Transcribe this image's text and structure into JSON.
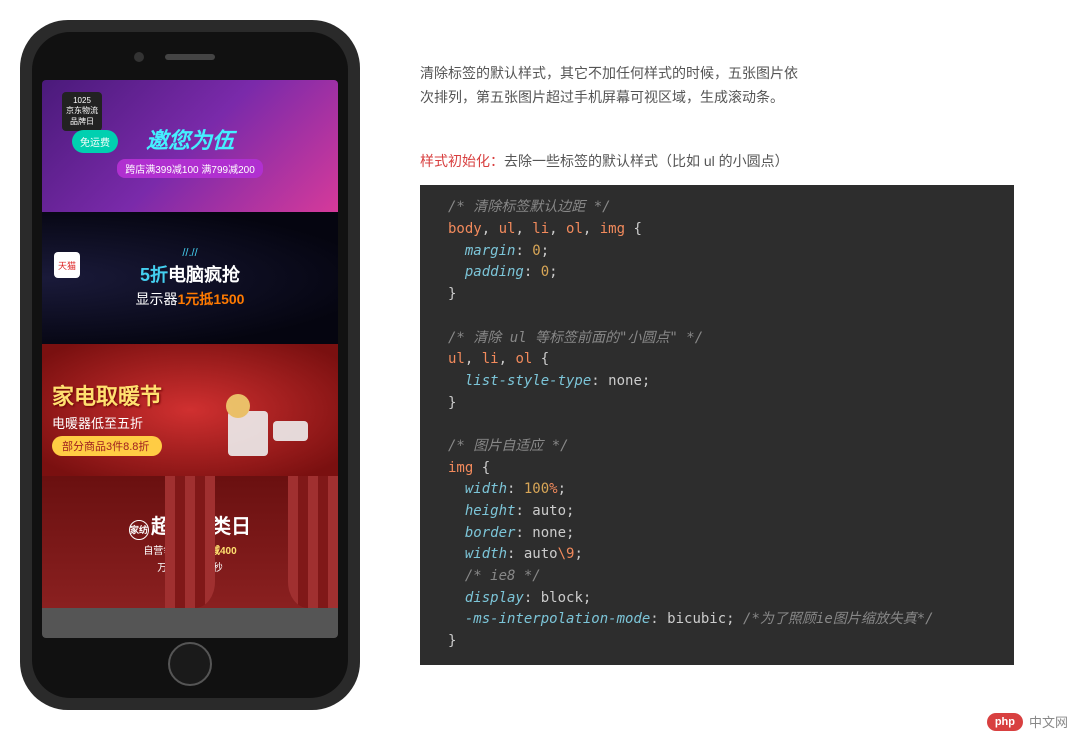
{
  "phone": {
    "banners": [
      {
        "jd_logo_l1": "1025",
        "jd_logo_l2": "京东物流",
        "jd_logo_l3": "品牌日",
        "free_ship": "免运费",
        "main": "邀您为伍",
        "sub": "跨店满399减100  满799减200"
      },
      {
        "tmall": "天猫",
        "date": "//.//",
        "main_cyan": "5折",
        "main_white": "电脑疯抢",
        "sub_pre": "显示器",
        "sub_mid": "1元抵",
        "sub_price": "1500"
      },
      {
        "main": "家电取暖节",
        "sub1": "电暖器低至五折",
        "sub2": "部分商品3件8.8折"
      },
      {
        "tag": "家纺",
        "main": "超级品类日",
        "sub1_pre": "自营领券满",
        "sub1_num": "799减400",
        "sub2_pre": "万件商品",
        "sub2_num": "1元",
        "sub2_suf": "秒"
      }
    ]
  },
  "desc": {
    "l1": "清除标签的默认样式，其它不加任何样式的时候，五张图片依",
    "l2": "次排列，第五张图片超过手机屏幕可视区域，生成滚动条。"
  },
  "init": {
    "label": "样式初始化：",
    "text": "去除一些标签的默认样式（比如 ul 的小圆点）"
  },
  "code": {
    "c1": "/* 清除标签默认边距 */",
    "s1": "body",
    "s1b": "ul",
    "s1c": "li",
    "s1d": "ol",
    "s1e": "img",
    "p_margin": "margin",
    "v_zero": "0",
    "p_padding": "padding",
    "c2": "/* 清除 ul 等标签前面的\"小圆点\" */",
    "s2a": "ul",
    "s2b": "li",
    "s2c": "ol",
    "p_lst": "list-style-type",
    "v_none": "none",
    "c3": "/* 图片自适应 */",
    "s3": "img",
    "p_width": "width",
    "v_100": "100",
    "pct": "%",
    "p_height": "height",
    "v_auto": "auto",
    "p_border": "border",
    "esc9": "\\9",
    "c4": "/* ie8 */",
    "p_display": "display",
    "v_block": "block",
    "p_msim": "-ms-interpolation-mode",
    "v_bicubic": "bicubic",
    "c5": "/*为了照顾ie图片缩放失真*/"
  },
  "watermark": {
    "badge": "php",
    "text": "中文网"
  }
}
